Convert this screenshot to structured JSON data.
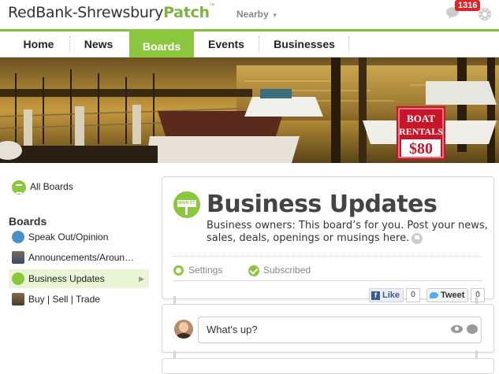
{
  "header": {
    "site_name": "RedBank-Shrewsbury",
    "brand": "Patch",
    "nearby_label": "Nearby",
    "notification_count": "1316"
  },
  "nav": {
    "items": [
      {
        "label": "Home"
      },
      {
        "label": "News"
      },
      {
        "label": "Boards"
      },
      {
        "label": "Events"
      },
      {
        "label": "Businesses"
      }
    ],
    "active": "Boards",
    "accent_color": "#8cc63f"
  },
  "hero": {
    "sign_line1": "BOAT",
    "sign_line2": "RENTALS",
    "sign_price": "$80"
  },
  "sidebar": {
    "all_boards_label": "All Boards",
    "heading": "Boards",
    "items": [
      {
        "label": "Speak Out/Opinion",
        "icon": "speech-bubble-icon"
      },
      {
        "label": "Announcements/Aroun…",
        "icon": "announcement-thumbnail"
      },
      {
        "label": "Business Updates",
        "icon": "main-st-sign-icon"
      },
      {
        "label": "Buy | Sell | Trade",
        "icon": "marketplace-thumbnail"
      }
    ],
    "active": "Business Updates"
  },
  "board": {
    "logo_text": "MAIN ST.",
    "title": "Business Updates",
    "description": "Business owners: This board’s for you. Post your news, sales, deals, openings or musings here.",
    "settings_label": "Settings",
    "subscribed_label": "Subscribed",
    "like_label": "Like",
    "like_count": "0",
    "tweet_label": "Tweet",
    "tweet_count": "0"
  },
  "post": {
    "placeholder": "What's up?"
  }
}
